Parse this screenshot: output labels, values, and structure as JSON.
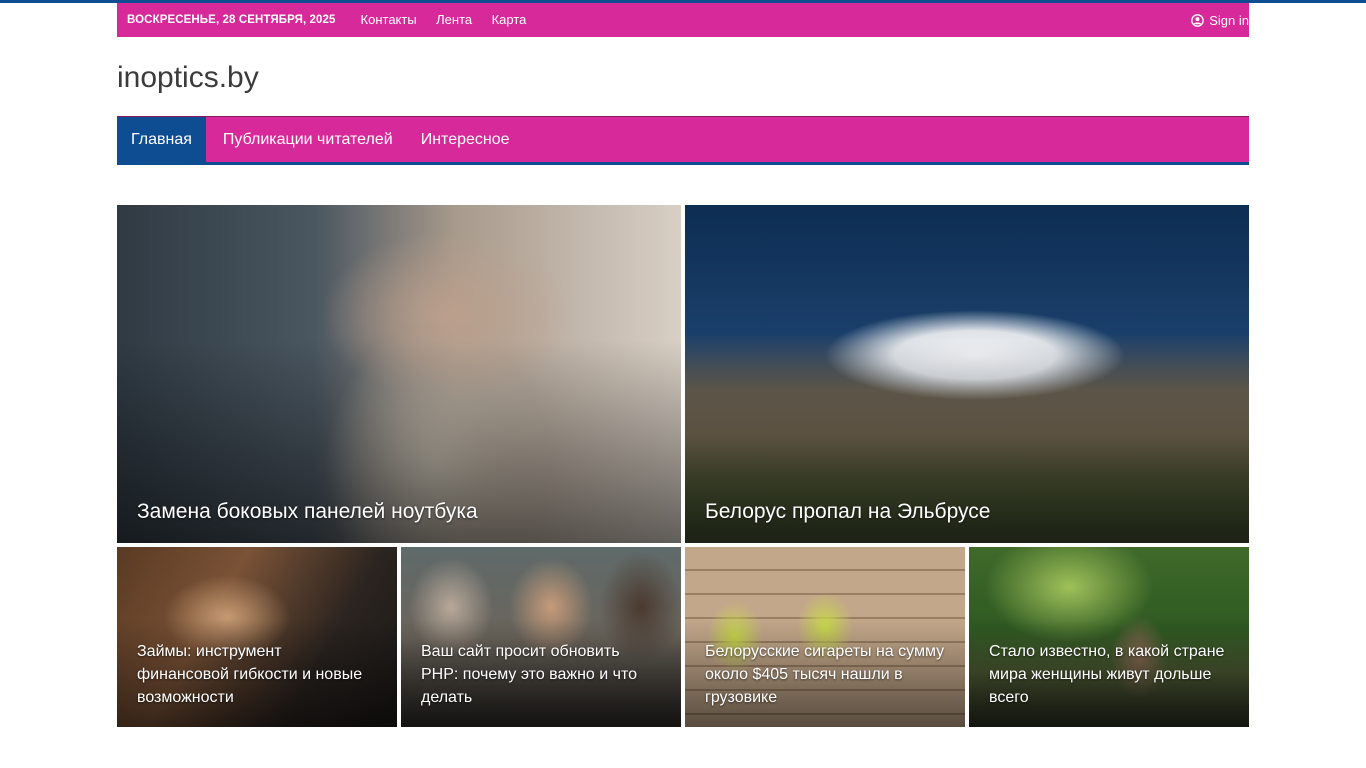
{
  "topbar": {
    "date": "ВОСКРЕСЕНЬЕ, 28 СЕНТЯБРЯ, 2025",
    "links": [
      "Контакты",
      "Лента",
      "Карта"
    ],
    "signin": "Sign in"
  },
  "site": {
    "logo": "inoptics.by"
  },
  "nav": {
    "items": [
      "Главная",
      "Публикации читателей",
      "Интересное"
    ],
    "active": 0
  },
  "featured": [
    {
      "title": "Замена боковых панелей ноутбука"
    },
    {
      "title": "Белорус пропал на Эльбрусе"
    }
  ],
  "cards": [
    {
      "title": "Займы: инструмент финансовой гибкости и новые возможности"
    },
    {
      "title": "Ваш сайт просит обновить PHP: почему это важно и что делать"
    },
    {
      "title": "Белорусские сигареты на сумму около $405 тысяч нашли в грузовике"
    },
    {
      "title": "Стало известно, в какой стране мира женщины живут дольше всего"
    }
  ],
  "colors": {
    "brand": "#d8299a",
    "accent": "#0f4d92"
  }
}
